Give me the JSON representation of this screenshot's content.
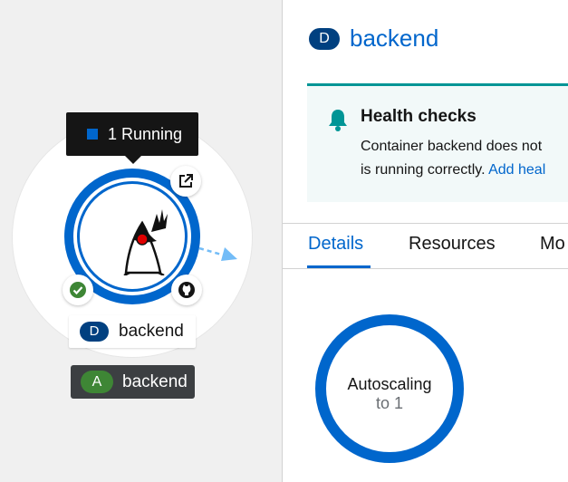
{
  "topology": {
    "tooltip": "1 Running",
    "node_label": {
      "badge": "D",
      "name": "backend"
    },
    "app_group": {
      "badge": "A",
      "name": "backend"
    }
  },
  "details_panel": {
    "header": {
      "badge": "D",
      "title": "backend"
    },
    "alert": {
      "title": "Health checks",
      "line1": "Container backend does not",
      "line2_text": "is running correctly.",
      "line2_link": "Add heal"
    },
    "tabs": [
      {
        "label": "Details",
        "active": true
      },
      {
        "label": "Resources",
        "active": false
      },
      {
        "label": "Mo",
        "active": false
      }
    ],
    "autoscaling": {
      "line1": "Autoscaling",
      "line2": "to 1"
    }
  },
  "colors": {
    "accent": "#0066cc",
    "deployment_badge": "#004080",
    "application_badge": "#3e8635",
    "alert_border": "#009596"
  },
  "icons": [
    "external-link-icon",
    "check-circle-icon",
    "github-icon",
    "bell-icon",
    "java-duke-icon",
    "arrow-icon"
  ]
}
